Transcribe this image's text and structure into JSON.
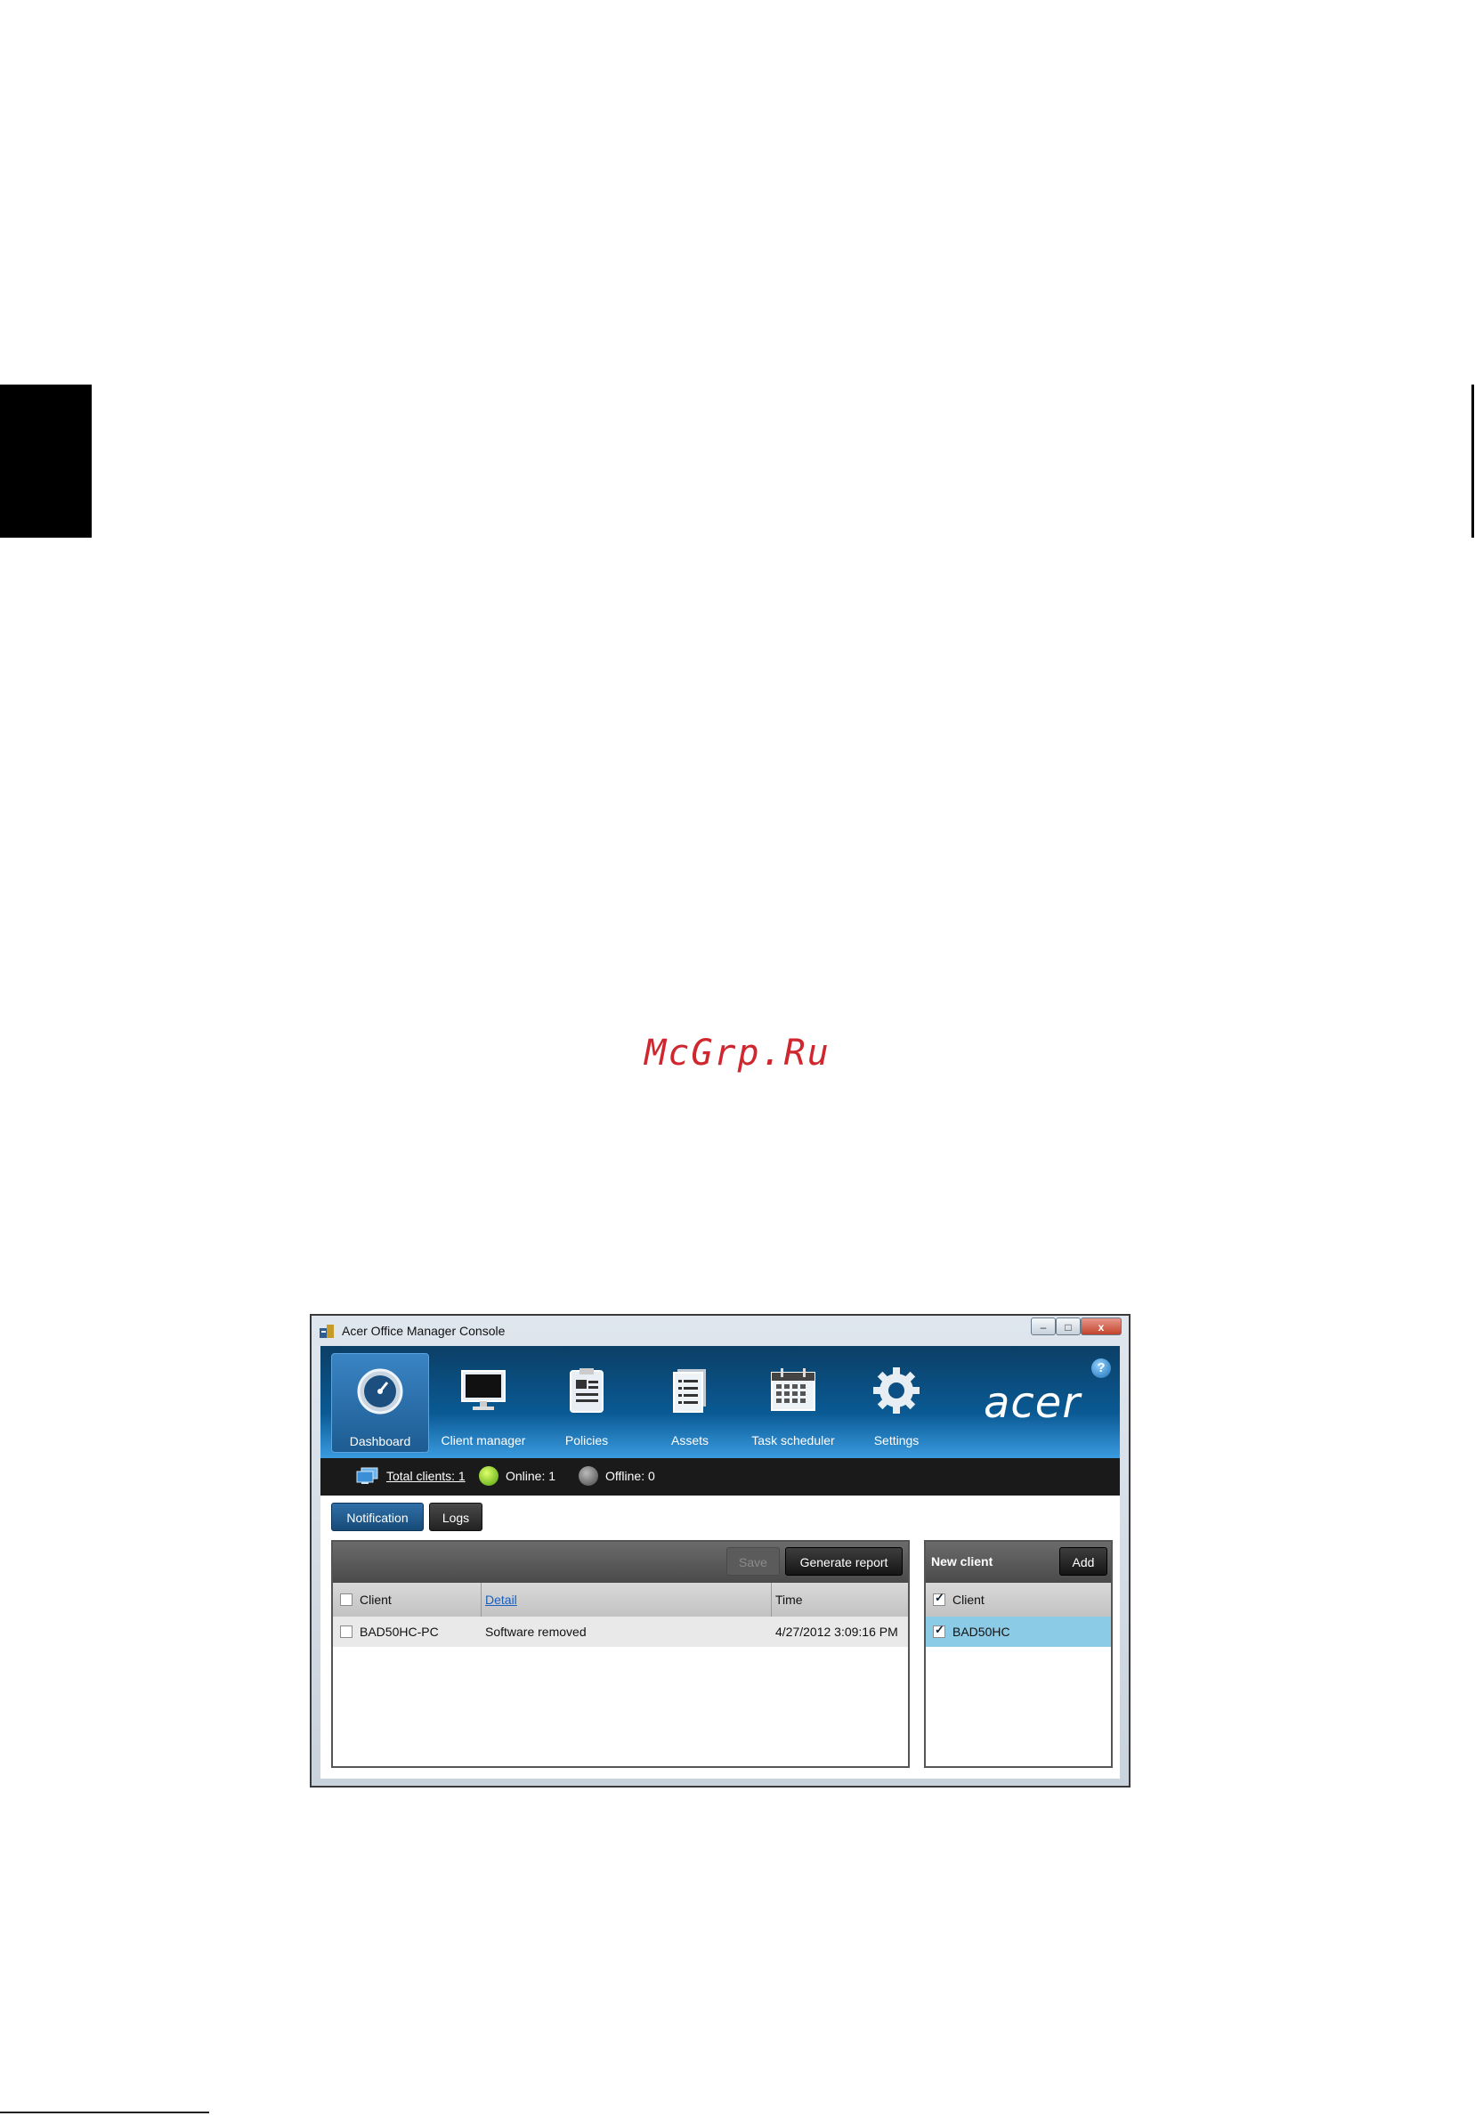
{
  "watermark": "McGrp.Ru",
  "window": {
    "title": "Acer Office Manager Console",
    "controls": {
      "minimize": "–",
      "maximize": "□",
      "close": "x"
    }
  },
  "nav": {
    "items": [
      {
        "label": "Dashboard",
        "icon": "dashboard-gauge-icon",
        "active": true
      },
      {
        "label": "Client manager",
        "icon": "monitor-icon"
      },
      {
        "label": "Policies",
        "icon": "clipboard-icon"
      },
      {
        "label": "Assets",
        "icon": "document-list-icon"
      },
      {
        "label": "Task scheduler",
        "icon": "calendar-icon"
      },
      {
        "label": "Settings",
        "icon": "gear-icon"
      }
    ],
    "logo": "acer",
    "help": "?"
  },
  "status": {
    "total_clients": "Total clients: 1",
    "online": "Online: 1",
    "offline": "Offline: 0"
  },
  "tabs": {
    "notification": "Notification",
    "logs": "Logs"
  },
  "notifications": {
    "save_label": "Save",
    "report_label": "Generate report",
    "columns": {
      "client": "Client",
      "detail": "Detail",
      "time": "Time"
    },
    "rows": [
      {
        "client": "BAD50HC-PC",
        "detail": "Software removed",
        "time": "4/27/2012 3:09:16 PM"
      }
    ]
  },
  "new_client": {
    "title": "New client",
    "add_label": "Add",
    "column": "Client",
    "rows": [
      {
        "name": "BAD50HC",
        "checked": true
      }
    ]
  },
  "colors": {
    "accent": "#0a5a94",
    "selection": "#8ccbe6",
    "watermark": "#d0262e"
  }
}
